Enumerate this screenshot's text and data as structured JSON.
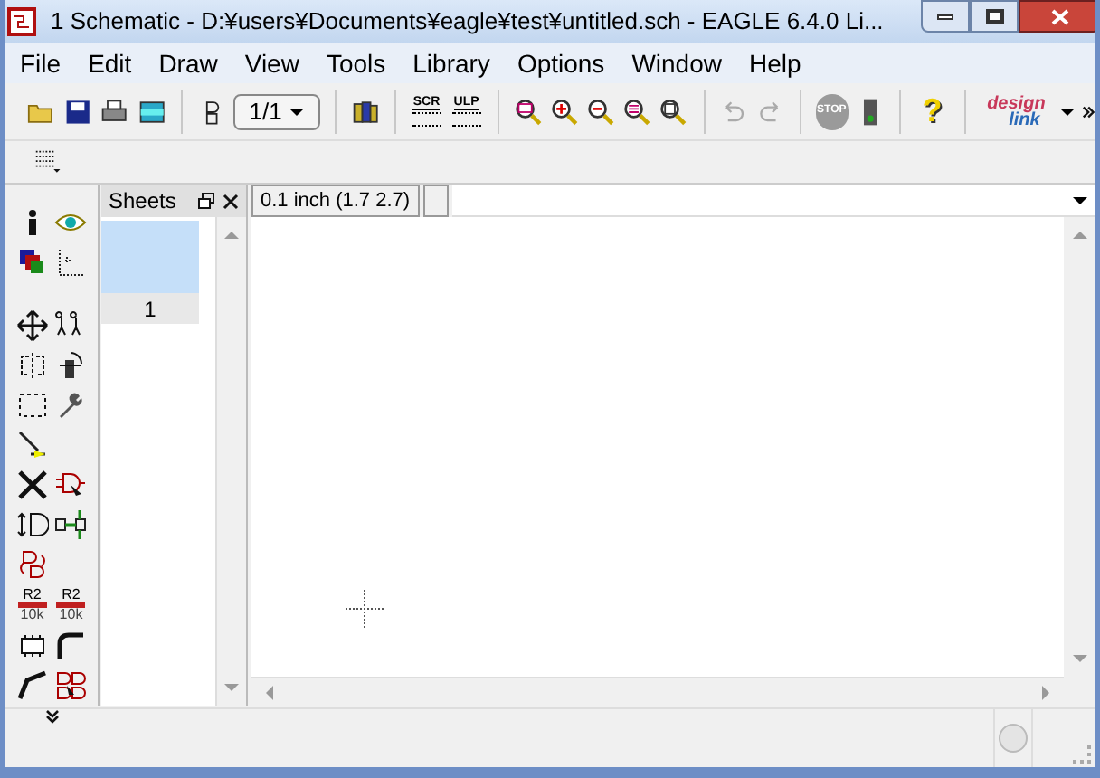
{
  "window": {
    "title": "1 Schematic - D:¥users¥Documents¥eagle¥test¥untitled.sch - EAGLE 6.4.0 Li..."
  },
  "menu": [
    "File",
    "Edit",
    "Draw",
    "View",
    "Tools",
    "Library",
    "Options",
    "Window",
    "Help"
  ],
  "toolbar": [
    {
      "kind": "open"
    },
    {
      "kind": "save"
    },
    {
      "kind": "print"
    },
    {
      "kind": "cam"
    },
    {
      "kind": "sep"
    },
    {
      "kind": "board"
    },
    {
      "kind": "select",
      "text": "1/1"
    },
    {
      "kind": "sep"
    },
    {
      "kind": "library"
    },
    {
      "kind": "sep"
    },
    {
      "kind": "script",
      "text": "SCR"
    },
    {
      "kind": "script",
      "text": "ULP"
    },
    {
      "kind": "sep"
    },
    {
      "kind": "zoom_fit"
    },
    {
      "kind": "zoom_in"
    },
    {
      "kind": "zoom_out"
    },
    {
      "kind": "zoom_area"
    },
    {
      "kind": "zoom_redraw"
    },
    {
      "kind": "sep"
    },
    {
      "kind": "undo",
      "disabled": true
    },
    {
      "kind": "redo",
      "disabled": true
    },
    {
      "kind": "sep"
    },
    {
      "kind": "stop",
      "text": "STOP",
      "disabled": true
    },
    {
      "kind": "go"
    },
    {
      "kind": "sep"
    },
    {
      "kind": "help",
      "text": "?"
    },
    {
      "kind": "sep"
    },
    {
      "kind": "logo",
      "line1": "design",
      "line2": "link"
    }
  ],
  "grid_button": {
    "kind": "grid"
  },
  "tools": [
    {
      "kind": "info"
    },
    {
      "kind": "eye"
    },
    {
      "kind": "layers"
    },
    {
      "kind": "mark"
    },
    {
      "kind": "sep"
    },
    {
      "kind": "move"
    },
    {
      "kind": "copy"
    },
    {
      "kind": "mirror"
    },
    {
      "kind": "rotate"
    },
    {
      "kind": "group"
    },
    {
      "kind": "wrench"
    },
    {
      "kind": "split"
    },
    {
      "kind": "blank"
    },
    {
      "kind": "delete"
    },
    {
      "kind": "add"
    },
    {
      "kind": "pinswap"
    },
    {
      "kind": "gateswap"
    },
    {
      "kind": "replace"
    },
    {
      "kind": "blank"
    },
    {
      "kind": "label",
      "top": "R2",
      "bottom": "10k"
    },
    {
      "kind": "label",
      "top": "R2",
      "bottom": "10k"
    },
    {
      "kind": "smash"
    },
    {
      "kind": "miter"
    },
    {
      "kind": "wire"
    },
    {
      "kind": "invoke"
    }
  ],
  "sheets": {
    "title": "Sheets",
    "items": [
      {
        "label": "1",
        "selected": true
      }
    ]
  },
  "coordinates": "0.1 inch (1.7 2.7)"
}
